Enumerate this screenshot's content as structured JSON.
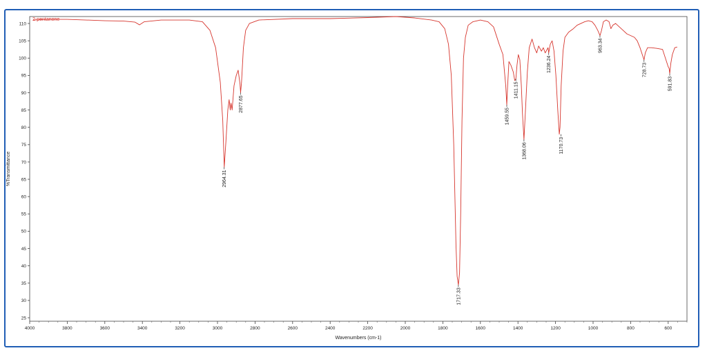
{
  "chart_data": {
    "type": "line",
    "sample_label": "2-pentanone",
    "xlabel": "Wavenumbers (cm-1)",
    "ylabel": "%Transmittance",
    "xlim": [
      4000,
      500
    ],
    "ylim": [
      24,
      112
    ],
    "x_reversed": true,
    "grid": false,
    "colors": {
      "line": "#d6342c",
      "frame": "#1f5db5"
    },
    "x_ticks": [
      4000,
      3800,
      3600,
      3400,
      3200,
      3000,
      2800,
      2600,
      2400,
      2200,
      2000,
      1800,
      1600,
      1400,
      1200,
      1000,
      800,
      600
    ],
    "y_ticks": [
      110,
      105,
      100,
      95,
      90,
      85,
      80,
      75,
      70,
      65,
      60,
      55,
      50,
      45,
      40,
      35,
      30,
      25
    ],
    "series": [
      {
        "points": [
          [
            3980,
            111.0
          ],
          [
            3900,
            111.2
          ],
          [
            3800,
            111.2
          ],
          [
            3700,
            111.0
          ],
          [
            3600,
            110.8
          ],
          [
            3500,
            110.7
          ],
          [
            3440,
            110.4
          ],
          [
            3415,
            109.6
          ],
          [
            3390,
            110.5
          ],
          [
            3300,
            111.0
          ],
          [
            3150,
            111.0
          ],
          [
            3080,
            110.5
          ],
          [
            3040,
            108.0
          ],
          [
            3010,
            103.0
          ],
          [
            2985,
            93.0
          ],
          [
            2972,
            82.0
          ],
          [
            2964,
            68.5
          ],
          [
            2955,
            76.0
          ],
          [
            2945,
            85.0
          ],
          [
            2938,
            88.0
          ],
          [
            2932,
            85.0
          ],
          [
            2928,
            87.0
          ],
          [
            2922,
            85.0
          ],
          [
            2912,
            92.0
          ],
          [
            2900,
            95.0
          ],
          [
            2890,
            96.5
          ],
          [
            2880,
            92.5
          ],
          [
            2877,
            90.0
          ],
          [
            2872,
            93.0
          ],
          [
            2862,
            103.0
          ],
          [
            2850,
            108.0
          ],
          [
            2830,
            110.0
          ],
          [
            2780,
            111.0
          ],
          [
            2600,
            111.4
          ],
          [
            2400,
            111.4
          ],
          [
            2200,
            111.7
          ],
          [
            2050,
            112.0
          ],
          [
            1950,
            111.6
          ],
          [
            1860,
            111.0
          ],
          [
            1820,
            110.5
          ],
          [
            1790,
            108.5
          ],
          [
            1770,
            104.0
          ],
          [
            1755,
            95.0
          ],
          [
            1742,
            75.0
          ],
          [
            1730,
            46.0
          ],
          [
            1724,
            37.0
          ],
          [
            1717.33,
            34.5
          ],
          [
            1711,
            38.0
          ],
          [
            1705,
            55.0
          ],
          [
            1698,
            82.0
          ],
          [
            1690,
            100.0
          ],
          [
            1680,
            106.0
          ],
          [
            1665,
            109.5
          ],
          [
            1640,
            110.5
          ],
          [
            1600,
            111.0
          ],
          [
            1560,
            110.5
          ],
          [
            1530,
            109.0
          ],
          [
            1500,
            104.0
          ],
          [
            1480,
            101.0
          ],
          [
            1465,
            92.0
          ],
          [
            1459.55,
            86.5
          ],
          [
            1455,
            92.0
          ],
          [
            1448,
            99.0
          ],
          [
            1438,
            98.0
          ],
          [
            1425,
            96.0
          ],
          [
            1417,
            93.5
          ],
          [
            1411.15,
            94.0
          ],
          [
            1405,
            98.0
          ],
          [
            1398,
            101.0
          ],
          [
            1390,
            99.5
          ],
          [
            1382,
            92.0
          ],
          [
            1376,
            84.0
          ],
          [
            1368.06,
            76.5
          ],
          [
            1360,
            85.0
          ],
          [
            1350,
            96.0
          ],
          [
            1340,
            103.0
          ],
          [
            1325,
            105.5
          ],
          [
            1312,
            103.0
          ],
          [
            1300,
            101.5
          ],
          [
            1290,
            103.5
          ],
          [
            1275,
            102.0
          ],
          [
            1265,
            103.0
          ],
          [
            1255,
            101.5
          ],
          [
            1240,
            103.0
          ],
          [
            1236.24,
            101.5
          ],
          [
            1228,
            104.0
          ],
          [
            1218,
            105.0
          ],
          [
            1208,
            102.0
          ],
          [
            1198,
            95.0
          ],
          [
            1188,
            85.0
          ],
          [
            1180,
            78.0
          ],
          [
            1176,
            80.0
          ],
          [
            1170,
            92.0
          ],
          [
            1160,
            102.0
          ],
          [
            1150,
            106.0
          ],
          [
            1130,
            107.5
          ],
          [
            1105,
            108.5
          ],
          [
            1085,
            109.5
          ],
          [
            1065,
            110.0
          ],
          [
            1045,
            110.5
          ],
          [
            1025,
            110.8
          ],
          [
            1005,
            110.5
          ],
          [
            990,
            109.5
          ],
          [
            975,
            108.0
          ],
          [
            963.34,
            106.5
          ],
          [
            955,
            108.0
          ],
          [
            945,
            110.5
          ],
          [
            930,
            111.0
          ],
          [
            915,
            110.5
          ],
          [
            905,
            108.5
          ],
          [
            895,
            109.5
          ],
          [
            880,
            110.0
          ],
          [
            860,
            109.0
          ],
          [
            840,
            108.0
          ],
          [
            820,
            107.0
          ],
          [
            800,
            106.5
          ],
          [
            780,
            106.0
          ],
          [
            765,
            105.0
          ],
          [
            750,
            103.0
          ],
          [
            738,
            101.0
          ],
          [
            728.73,
            99.5
          ],
          [
            722,
            101.5
          ],
          [
            710,
            103.0
          ],
          [
            690,
            103.0
          ],
          [
            660,
            102.8
          ],
          [
            630,
            102.5
          ],
          [
            615,
            100.0
          ],
          [
            600,
            97.5
          ],
          [
            595,
            97.0
          ],
          [
            591.83,
            95.5
          ],
          [
            586,
            98.5
          ],
          [
            578,
            101.0
          ],
          [
            565,
            103.0
          ],
          [
            552,
            103.2
          ]
        ]
      }
    ],
    "annotations": [
      {
        "label": "2964.31",
        "x": 2964.31,
        "y": 68.5
      },
      {
        "label": "2877.65",
        "x": 2877.65,
        "y": 90.0
      },
      {
        "label": "1717.33",
        "x": 1717.33,
        "y": 34.5
      },
      {
        "label": "1459.55",
        "x": 1459.55,
        "y": 86.5
      },
      {
        "label": "1411.15",
        "x": 1411.15,
        "y": 94.0
      },
      {
        "label": "1368.06",
        "x": 1368.06,
        "y": 76.5
      },
      {
        "label": "1236.24",
        "x": 1236.24,
        "y": 101.5
      },
      {
        "label": "1170.73",
        "x": 1170.73,
        "y": 78.0
      },
      {
        "label": "963.34",
        "x": 963.34,
        "y": 106.5
      },
      {
        "label": "728.73",
        "x": 728.73,
        "y": 99.5
      },
      {
        "label": "591.83",
        "x": 591.83,
        "y": 95.5
      }
    ]
  }
}
